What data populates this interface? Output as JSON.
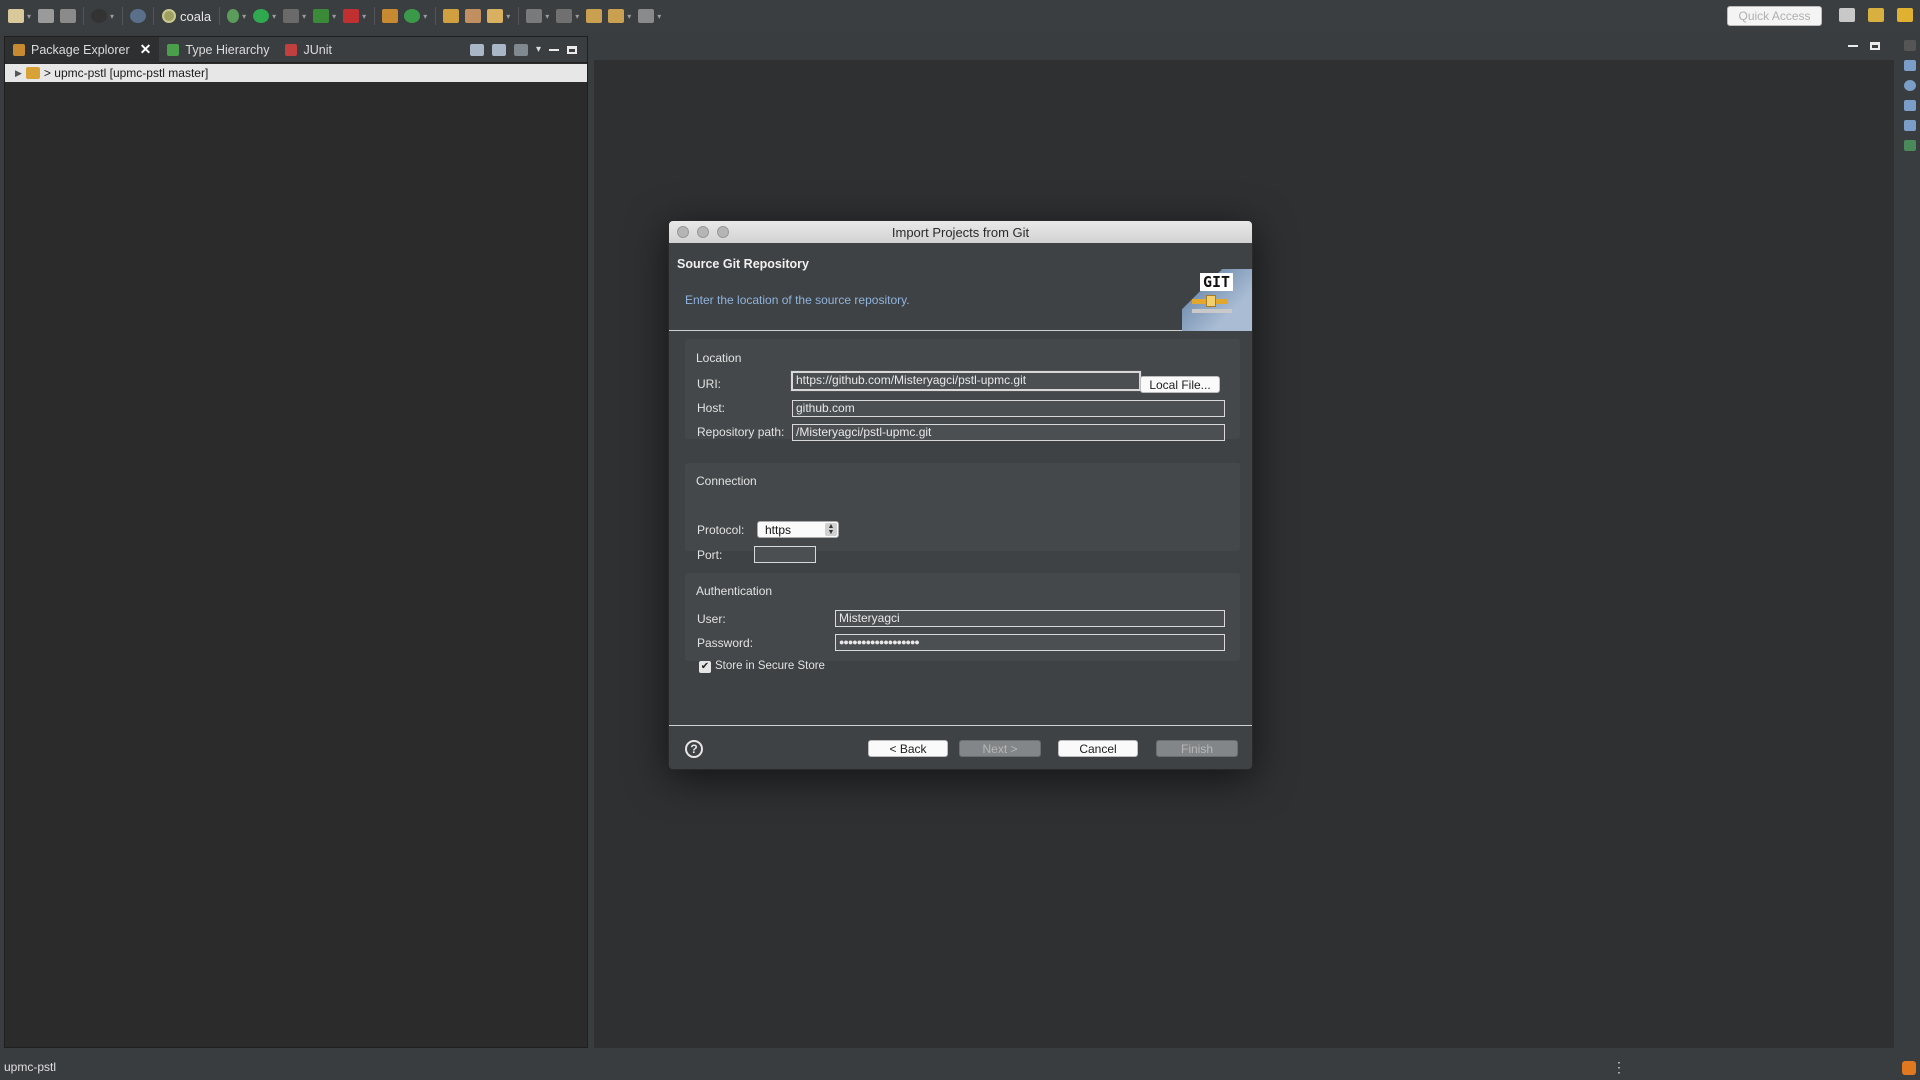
{
  "toolbar": {
    "run_config": "coala",
    "quick_access_placeholder": "Quick Access"
  },
  "left_pane": {
    "tabs": [
      {
        "label": "Package Explorer",
        "icon": "package-explorer-icon",
        "active": true,
        "closable": true
      },
      {
        "label": "Type Hierarchy",
        "icon": "type-hierarchy-icon",
        "active": false
      },
      {
        "label": "JUnit",
        "icon": "junit-icon",
        "active": false
      }
    ],
    "tree": [
      {
        "label": "> upmc-pstl [upmc-pstl master]",
        "icon": "git-project-icon",
        "expanded": false
      }
    ]
  },
  "dialog": {
    "title": "Import Projects from Git",
    "heading": "Source Git Repository",
    "subtitle": "Enter the location of the source repository.",
    "logo_text": "GIT",
    "location": {
      "section": "Location",
      "uri_label": "URI:",
      "uri_value": "https://github.com/Misteryagci/pstl-upmc.git",
      "local_file_button": "Local File...",
      "host_label": "Host:",
      "host_value": "github.com",
      "repo_path_label": "Repository path:",
      "repo_path_value": "/Misteryagci/pstl-upmc.git"
    },
    "connection": {
      "section": "Connection",
      "protocol_label": "Protocol:",
      "protocol_value": "https",
      "port_label": "Port:",
      "port_value": ""
    },
    "authentication": {
      "section": "Authentication",
      "user_label": "User:",
      "user_value": "Misteryagci",
      "password_label": "Password:",
      "password_value": "●●●●●●●●●●●●●●●●●●",
      "store_label": "Store in Secure Store",
      "store_checked": true
    },
    "buttons": {
      "help": "?",
      "back": "< Back",
      "next": "Next >",
      "cancel": "Cancel",
      "finish": "Finish"
    }
  },
  "status_bar": {
    "text": "upmc-pstl"
  },
  "colors": {
    "ide_background": "#3a3d40",
    "pane_background": "#2b2b2c",
    "dialog_background": "#3f4244",
    "subtitle_blue": "#8fb4de"
  }
}
